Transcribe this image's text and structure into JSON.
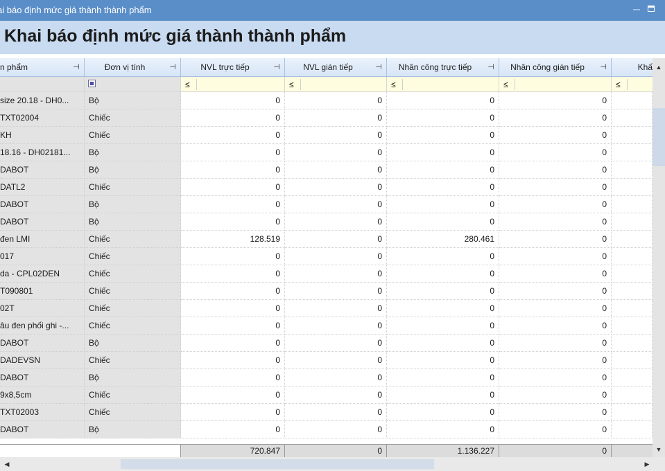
{
  "window": {
    "title": "ai báo định mức giá thành thành phẩm",
    "minimize_icon": "minimize-icon",
    "maximize_icon": "maximize-icon"
  },
  "page": {
    "heading": "Khai báo định mức giá thành thành phẩm"
  },
  "grid": {
    "columns": [
      {
        "label": "n phẩm",
        "pin_icon": "pin-icon"
      },
      {
        "label": "Đơn vị tính",
        "pin_icon": "pin-icon"
      },
      {
        "label": "NVL trực tiếp",
        "pin_icon": "pin-icon"
      },
      {
        "label": "NVL gián tiếp",
        "pin_icon": "pin-icon"
      },
      {
        "label": "Nhân công trực tiếp",
        "pin_icon": "pin-icon"
      },
      {
        "label": "Nhân công gián tiếp",
        "pin_icon": "pin-icon"
      },
      {
        "label": "Khấ",
        "pin_icon": ""
      }
    ],
    "filter": {
      "operator": "≤",
      "checkbox_icon": "checkbox-indeterminate-icon"
    },
    "rows": [
      {
        "name": "size 20.18 - DH0...",
        "unit": "Bộ",
        "nvl_tt": "0",
        "nvl_gt": "0",
        "nc_tt": "0",
        "nc_gt": "0"
      },
      {
        "name": "TXT02004",
        "unit": "Chiếc",
        "nvl_tt": "0",
        "nvl_gt": "0",
        "nc_tt": "0",
        "nc_gt": "0"
      },
      {
        "name": "KH",
        "unit": "Chiếc",
        "nvl_tt": "0",
        "nvl_gt": "0",
        "nc_tt": "0",
        "nc_gt": "0"
      },
      {
        "name": "18.16 - DH02181...",
        "unit": "Bộ",
        "nvl_tt": "0",
        "nvl_gt": "0",
        "nc_tt": "0",
        "nc_gt": "0"
      },
      {
        "name": "DABOT",
        "unit": "Bộ",
        "nvl_tt": "0",
        "nvl_gt": "0",
        "nc_tt": "0",
        "nc_gt": "0"
      },
      {
        "name": "DATL2",
        "unit": "Chiếc",
        "nvl_tt": "0",
        "nvl_gt": "0",
        "nc_tt": "0",
        "nc_gt": "0"
      },
      {
        "name": "DABOT",
        "unit": "Bộ",
        "nvl_tt": "0",
        "nvl_gt": "0",
        "nc_tt": "0",
        "nc_gt": "0"
      },
      {
        "name": "DABOT",
        "unit": "Bộ",
        "nvl_tt": "0",
        "nvl_gt": "0",
        "nc_tt": "0",
        "nc_gt": "0"
      },
      {
        "name": "đen LMI",
        "unit": "Chiếc",
        "nvl_tt": "128.519",
        "nvl_gt": "0",
        "nc_tt": "280.461",
        "nc_gt": "0"
      },
      {
        "name": "017",
        "unit": "Chiếc",
        "nvl_tt": "0",
        "nvl_gt": "0",
        "nc_tt": "0",
        "nc_gt": "0"
      },
      {
        "name": "da - CPL02DEN",
        "unit": "Chiếc",
        "nvl_tt": "0",
        "nvl_gt": "0",
        "nc_tt": "0",
        "nc_gt": "0"
      },
      {
        "name": "T090801",
        "unit": "Chiếc",
        "nvl_tt": "0",
        "nvl_gt": "0",
        "nc_tt": "0",
        "nc_gt": "0"
      },
      {
        "name": "02T",
        "unit": "Chiếc",
        "nvl_tt": "0",
        "nvl_gt": "0",
        "nc_tt": "0",
        "nc_gt": "0"
      },
      {
        "name": "âu đen phối ghi -...",
        "unit": "Chiếc",
        "nvl_tt": "0",
        "nvl_gt": "0",
        "nc_tt": "0",
        "nc_gt": "0"
      },
      {
        "name": "DABOT",
        "unit": "Bộ",
        "nvl_tt": "0",
        "nvl_gt": "0",
        "nc_tt": "0",
        "nc_gt": "0"
      },
      {
        "name": "DADEVSN",
        "unit": "Chiếc",
        "nvl_tt": "0",
        "nvl_gt": "0",
        "nc_tt": "0",
        "nc_gt": "0"
      },
      {
        "name": "DABOT",
        "unit": "Bộ",
        "nvl_tt": "0",
        "nvl_gt": "0",
        "nc_tt": "0",
        "nc_gt": "0"
      },
      {
        "name": "9x8,5cm",
        "unit": "Chiếc",
        "nvl_tt": "0",
        "nvl_gt": "0",
        "nc_tt": "0",
        "nc_gt": "0"
      },
      {
        "name": "TXT02003",
        "unit": "Chiếc",
        "nvl_tt": "0",
        "nvl_gt": "0",
        "nc_tt": "0",
        "nc_gt": "0"
      },
      {
        "name": "DABOT",
        "unit": "Bộ",
        "nvl_tt": "0",
        "nvl_gt": "0",
        "nc_tt": "0",
        "nc_gt": "0"
      }
    ],
    "totals": {
      "nvl_tt": "720.847",
      "nvl_gt": "0",
      "nc_tt": "1.136.227",
      "nc_gt": "0"
    }
  },
  "scrollbars": {
    "up_icon": "▲",
    "down_icon": "▼",
    "left_icon": "◀",
    "right_icon": "▶"
  }
}
